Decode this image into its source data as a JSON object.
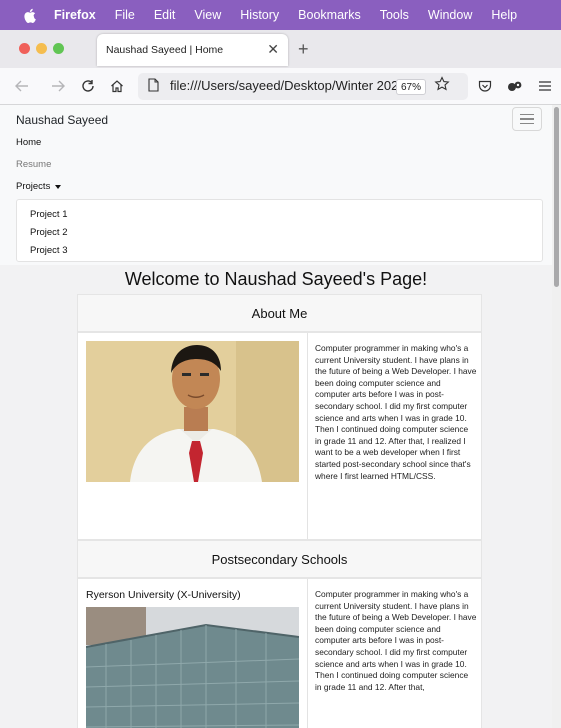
{
  "menubar": {
    "app": "Firefox",
    "items": [
      "File",
      "Edit",
      "View",
      "History",
      "Bookmarks",
      "Tools",
      "Window",
      "Help"
    ]
  },
  "tab": {
    "title": "Naushad Sayeed | Home"
  },
  "toolbar": {
    "url": "file:///Users/sayeed/Desktop/Winter 202",
    "zoom": "67%"
  },
  "site": {
    "brand": "Naushad Sayeed",
    "nav": {
      "home": "Home",
      "resume": "Resume",
      "projects": "Projects"
    },
    "projects_menu": [
      "Project 1",
      "Project 2",
      "Project 3"
    ],
    "heading": "Welcome to Naushad Sayeed's Page!",
    "about": {
      "title": "About Me",
      "text": "Computer programmer in making who's a current University student. I have plans in the future of being a Web Developer. I have been doing computer science and computer arts before I was in post-secondary school. I did my first computer science and arts when I was in grade 10. Then I continued doing computer science in grade 11 and 12. After that, I realized I want to be a web developer when I first started post-secondary school since that's where I first learned HTML/CSS."
    },
    "post": {
      "title": "Postsecondary Schools",
      "school": "Ryerson University (X-University)",
      "text": "Computer programmer in making who's a current University student. I have plans in the future of being a Web Developer. I have been doing computer science and computer arts before I was in post-secondary school. I did my first computer science and arts when I was in grade 10. Then I continued doing computer science in grade 11 and 12. After that,"
    }
  },
  "colors": {
    "menubar": "#8a5fbf",
    "tabstrip": "#e9e8ec",
    "page_bg": "#f2f2f3"
  }
}
